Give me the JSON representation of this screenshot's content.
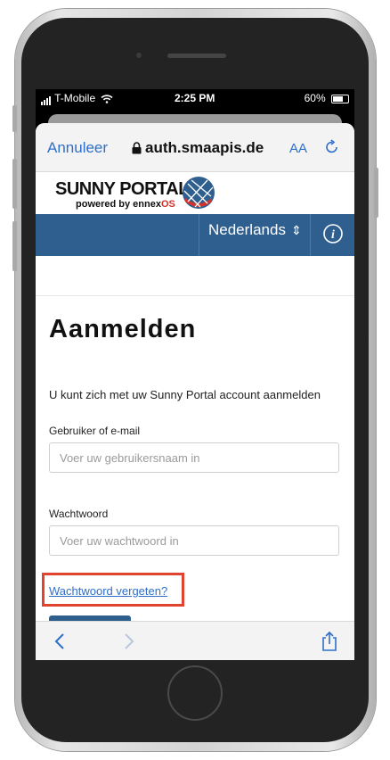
{
  "status_bar": {
    "carrier": "T-Mobile",
    "time": "2:25 PM",
    "battery": "60%"
  },
  "browser": {
    "cancel_label": "Annuleer",
    "url": "auth.smaapis.de",
    "text_size_label": "AA"
  },
  "brand": {
    "name": "SUNNY PORTAL",
    "tagline_prefix": "powered by ennex",
    "tagline_os": "OS"
  },
  "header": {
    "language": "Nederlands"
  },
  "login": {
    "title": "Aanmelden",
    "description": "U kunt zich met uw Sunny Portal account aanmelden",
    "user_label": "Gebruiker of e-mail",
    "user_placeholder": "Voer uw gebruikersnaam in",
    "password_label": "Wachtwoord",
    "password_placeholder": "Voer uw wachtwoord in",
    "forgot_link": "Wachtwoord vergeten?"
  },
  "colors": {
    "brand_blue": "#2f5f8f",
    "link_blue": "#2f6fc9",
    "highlight_red": "#e0432e"
  }
}
